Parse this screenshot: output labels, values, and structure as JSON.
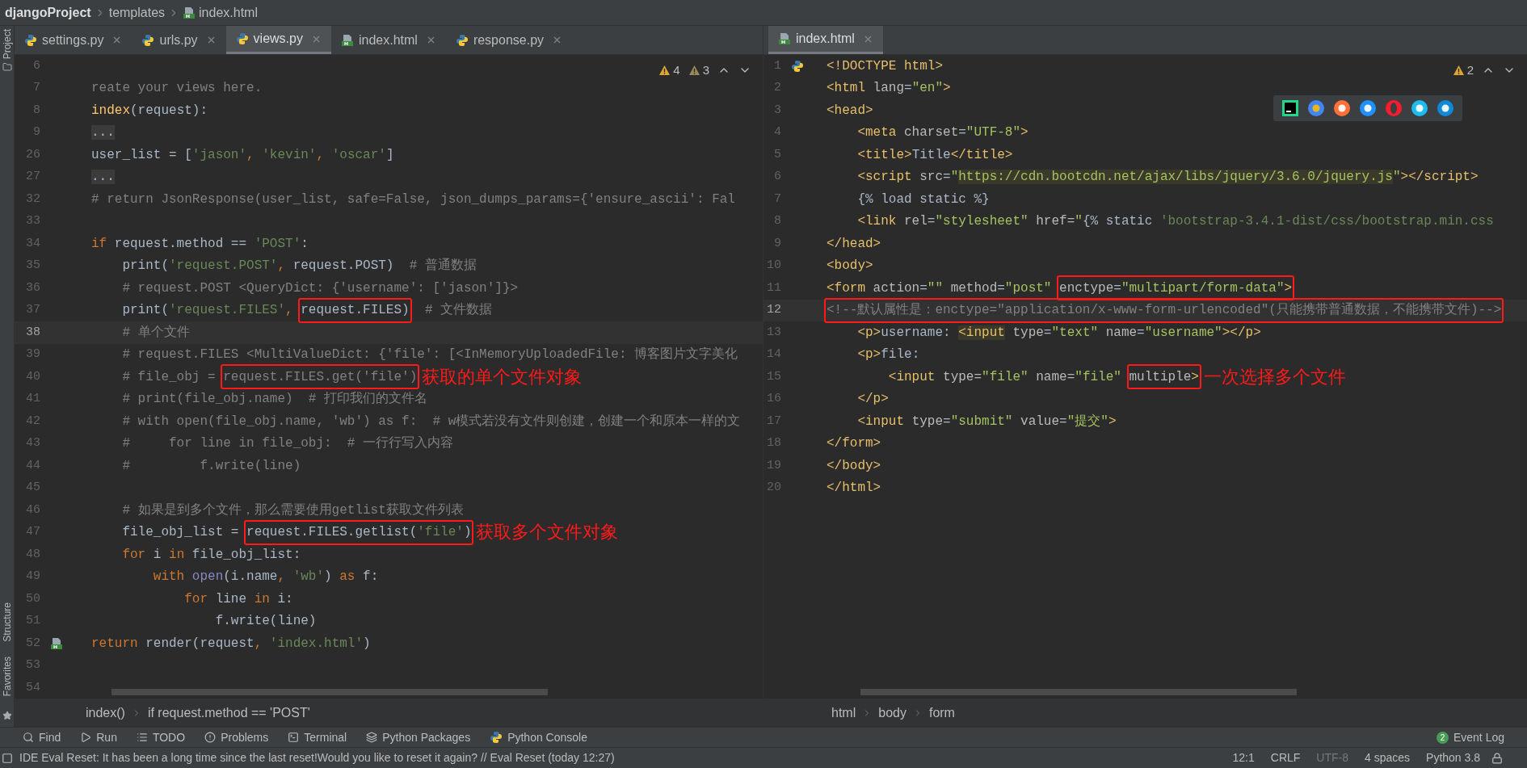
{
  "breadcrumb": [
    {
      "label": "djangoProject",
      "kind": "project"
    },
    {
      "label": "templates",
      "kind": "folder"
    },
    {
      "label": "index.html",
      "kind": "html"
    }
  ],
  "side_tools": [
    {
      "label": "Project",
      "kind": "top"
    },
    {
      "label": "Structure",
      "kind": "bottom"
    },
    {
      "label": "Favorites",
      "kind": "bottom"
    }
  ],
  "left_editor": {
    "tabs": [
      {
        "label": "settings.py",
        "kind": "py",
        "selected": false
      },
      {
        "label": "urls.py",
        "kind": "py",
        "selected": false
      },
      {
        "label": "views.py",
        "kind": "py",
        "selected": true
      },
      {
        "label": "index.html",
        "kind": "html",
        "selected": false
      },
      {
        "label": "response.py",
        "kind": "py",
        "selected": false
      }
    ],
    "warnings": "4",
    "weak_warnings": "3",
    "lines": [
      {
        "n": "6",
        "current": false
      },
      {
        "n": "7",
        "current": false,
        "segs": [
          {
            "kind": "comment",
            "text": "reate your views here."
          }
        ]
      },
      {
        "n": "8",
        "current": false,
        "segs": [
          {
            "kind": "def",
            "text": "index"
          },
          {
            "kind": "plain",
            "text": "(request):"
          }
        ]
      },
      {
        "n": "9",
        "current": false,
        "segs": [
          {
            "kind": "fold",
            "text": "..."
          }
        ]
      },
      {
        "n": "26",
        "current": false,
        "segs": [
          {
            "kind": "plain",
            "text": "user_list = ["
          },
          {
            "kind": "string",
            "text": "'jason'"
          },
          {
            "kind": "keyword",
            "text": ", "
          },
          {
            "kind": "string",
            "text": "'kevin'"
          },
          {
            "kind": "keyword",
            "text": ", "
          },
          {
            "kind": "string",
            "text": "'oscar'"
          },
          {
            "kind": "plain",
            "text": "]"
          }
        ]
      },
      {
        "n": "27",
        "current": false,
        "segs": [
          {
            "kind": "fold",
            "text": "..."
          }
        ]
      },
      {
        "n": "32",
        "current": false,
        "segs": [
          {
            "kind": "comment",
            "text": "# return JsonResponse(user_list, safe=False, json_dumps_params={'ensure_ascii': Fal"
          }
        ]
      },
      {
        "n": "33",
        "current": false
      },
      {
        "n": "34",
        "current": false,
        "segs": [
          {
            "kind": "keyword",
            "text": "if"
          },
          {
            "kind": "plain",
            "text": " request.method == "
          },
          {
            "kind": "string",
            "text": "'POST'"
          },
          {
            "kind": "plain",
            "text": ":"
          }
        ]
      },
      {
        "n": "35",
        "current": false,
        "segs": [
          {
            "kind": "plain",
            "text": "    print("
          },
          {
            "kind": "string",
            "text": "'request.POST'"
          },
          {
            "kind": "keyword",
            "text": ", "
          },
          {
            "kind": "plain",
            "text": "request.POST)  "
          },
          {
            "kind": "comment",
            "text": "# 普通数据"
          }
        ]
      },
      {
        "n": "36",
        "current": false,
        "segs": [
          {
            "kind": "comment",
            "text": "    # request.POST <QueryDict: {'username': ['jason']}>"
          }
        ]
      },
      {
        "n": "37",
        "current": false,
        "segs": [
          {
            "kind": "plain",
            "text": "    print("
          },
          {
            "kind": "string",
            "text": "'request.FILES'"
          },
          {
            "kind": "keyword",
            "text": ", "
          },
          {
            "kind": "box",
            "segs": [
              {
                "kind": "plain",
                "text": "request.FILES)"
              }
            ]
          },
          {
            "kind": "comment",
            "text": "  # 文件数据"
          }
        ]
      },
      {
        "n": "38",
        "current": true,
        "segs": [
          {
            "kind": "comment",
            "text": "    # 单个文件"
          }
        ]
      },
      {
        "n": "39",
        "current": false,
        "segs": [
          {
            "kind": "comment",
            "text": "    # request.FILES <MultiValueDict: {'file': [<InMemoryUploadedFile: 博客图片文字美化"
          }
        ]
      },
      {
        "n": "40",
        "current": false,
        "segs": [
          {
            "kind": "comment",
            "text": "    # file_obj = "
          },
          {
            "kind": "box",
            "segs": [
              {
                "kind": "comment",
                "text": "request.FILES.get('file')"
              }
            ]
          }
        ],
        "note": "获取的单个文件对象"
      },
      {
        "n": "41",
        "current": false,
        "segs": [
          {
            "kind": "comment",
            "text": "    # print(file_obj.name)  # 打印我们的文件名"
          }
        ]
      },
      {
        "n": "42",
        "current": false,
        "segs": [
          {
            "kind": "comment",
            "text": "    # with open(file_obj.name, 'wb') as f:  # w模式若没有文件则创建，创建一个和原本一样的文"
          }
        ]
      },
      {
        "n": "43",
        "current": false,
        "segs": [
          {
            "kind": "comment",
            "text": "    #     for line in file_obj:  # 一行行写入内容"
          }
        ]
      },
      {
        "n": "44",
        "current": false,
        "segs": [
          {
            "kind": "comment",
            "text": "    #         f.write(line)"
          }
        ]
      },
      {
        "n": "45",
        "current": false
      },
      {
        "n": "46",
        "current": false,
        "segs": [
          {
            "kind": "comment",
            "text": "    # 如果是到多个文件，那么需要使用getlist获取文件列表"
          }
        ]
      },
      {
        "n": "47",
        "current": false,
        "segs": [
          {
            "kind": "plain",
            "text": "    file_obj_list = "
          },
          {
            "kind": "box",
            "segs": [
              {
                "kind": "plain",
                "text": "request.FILES.getlist("
              },
              {
                "kind": "string",
                "text": "'file'"
              },
              {
                "kind": "plain",
                "text": ")"
              }
            ]
          }
        ],
        "note": "获取多个文件对象"
      },
      {
        "n": "48",
        "current": false,
        "segs": [
          {
            "kind": "keyword",
            "text": "    for"
          },
          {
            "kind": "plain",
            "text": " i "
          },
          {
            "kind": "keyword",
            "text": "in"
          },
          {
            "kind": "plain",
            "text": " file_obj_list:"
          }
        ]
      },
      {
        "n": "49",
        "current": false,
        "segs": [
          {
            "kind": "keyword",
            "text": "        with"
          },
          {
            "kind": "builtin",
            "text": " open"
          },
          {
            "kind": "plain",
            "text": "(i.name"
          },
          {
            "kind": "keyword",
            "text": ", "
          },
          {
            "kind": "string",
            "text": "'wb'"
          },
          {
            "kind": "plain",
            "text": ") "
          },
          {
            "kind": "keyword",
            "text": "as"
          },
          {
            "kind": "plain",
            "text": " f:"
          }
        ]
      },
      {
        "n": "50",
        "current": false,
        "segs": [
          {
            "kind": "keyword",
            "text": "            for"
          },
          {
            "kind": "plain",
            "text": " line "
          },
          {
            "kind": "keyword",
            "text": "in"
          },
          {
            "kind": "plain",
            "text": " i:"
          }
        ]
      },
      {
        "n": "51",
        "current": false,
        "segs": [
          {
            "kind": "plain",
            "text": "                f.write(line)"
          }
        ]
      },
      {
        "n": "52",
        "current": false,
        "icon": {
          "kind": "html"
        },
        "segs": [
          {
            "kind": "keyword",
            "text": "return"
          },
          {
            "kind": "plain",
            "text": " render(request"
          },
          {
            "kind": "keyword",
            "text": ", "
          },
          {
            "kind": "string",
            "text": "'index.html'"
          },
          {
            "kind": "plain",
            "text": ")"
          }
        ]
      },
      {
        "n": "53",
        "current": false
      },
      {
        "n": "54",
        "current": false
      }
    ],
    "crumbs": [
      "index()",
      "if request.method == 'POST'"
    ]
  },
  "right_editor": {
    "tabs": [
      {
        "label": "index.html",
        "kind": "html",
        "selected": true
      }
    ],
    "warnings": "2",
    "lines": [
      {
        "n": "1",
        "current": false,
        "icon": {
          "kind": "python"
        },
        "segs": [
          {
            "kind": "tag",
            "text": "<!DOCTYPE html>"
          }
        ]
      },
      {
        "n": "2",
        "current": false,
        "segs": [
          {
            "kind": "tag",
            "text": "<html "
          },
          {
            "kind": "attr",
            "text": "lang"
          },
          {
            "kind": "plain",
            "text": "="
          },
          {
            "kind": "value",
            "text": "\"en\""
          },
          {
            "kind": "tag",
            "text": ">"
          }
        ]
      },
      {
        "n": "3",
        "current": false,
        "segs": [
          {
            "kind": "tag",
            "text": "<head>"
          }
        ]
      },
      {
        "n": "4",
        "current": false,
        "segs": [
          {
            "kind": "tag",
            "text": "    <meta "
          },
          {
            "kind": "attr",
            "text": "charset"
          },
          {
            "kind": "plain",
            "text": "="
          },
          {
            "kind": "value",
            "text": "\"UTF-8\""
          },
          {
            "kind": "tag",
            "text": ">"
          }
        ]
      },
      {
        "n": "5",
        "current": false,
        "segs": [
          {
            "kind": "tag",
            "text": "    <title>"
          },
          {
            "kind": "plain",
            "text": "Title"
          },
          {
            "kind": "tag",
            "text": "</title>"
          }
        ]
      },
      {
        "n": "6",
        "current": false,
        "segs": [
          {
            "kind": "tag",
            "text": "    <script "
          },
          {
            "kind": "attr",
            "text": "src"
          },
          {
            "kind": "plain",
            "text": "="
          },
          {
            "kind": "value",
            "text": "\""
          },
          {
            "kind": "url",
            "text": "https://cdn.bootcdn.net/ajax/libs/jquery/3.6.0/jquery.js"
          },
          {
            "kind": "value",
            "text": "\""
          },
          {
            "kind": "tag",
            "text": "></script>"
          }
        ]
      },
      {
        "n": "7",
        "current": false,
        "segs": [
          {
            "kind": "plain",
            "text": "    {% load static %}"
          }
        ]
      },
      {
        "n": "8",
        "current": false,
        "segs": [
          {
            "kind": "tag",
            "text": "    <link "
          },
          {
            "kind": "attr",
            "text": "rel"
          },
          {
            "kind": "plain",
            "text": "="
          },
          {
            "kind": "value",
            "text": "\"stylesheet\""
          },
          {
            "kind": "attr",
            "text": " href"
          },
          {
            "kind": "plain",
            "text": "="
          },
          {
            "kind": "value",
            "text": "\""
          },
          {
            "kind": "plain",
            "text": "{% static "
          },
          {
            "kind": "string",
            "text": "'bootstrap-3.4.1-dist/css/bootstrap.min.css"
          }
        ]
      },
      {
        "n": "9",
        "current": false,
        "segs": [
          {
            "kind": "tag",
            "text": "</head>"
          }
        ]
      },
      {
        "n": "10",
        "current": false,
        "segs": [
          {
            "kind": "tag",
            "text": "<body>"
          }
        ]
      },
      {
        "n": "11",
        "current": false,
        "segs": [
          {
            "kind": "tag",
            "text": "<form "
          },
          {
            "kind": "attr",
            "text": "action"
          },
          {
            "kind": "plain",
            "text": "="
          },
          {
            "kind": "value",
            "text": "\"\""
          },
          {
            "kind": "attr",
            "text": " method"
          },
          {
            "kind": "plain",
            "text": "="
          },
          {
            "kind": "value",
            "text": "\"post\" "
          },
          {
            "kind": "box",
            "segs": [
              {
                "kind": "attr",
                "text": "enctype"
              },
              {
                "kind": "plain",
                "text": "="
              },
              {
                "kind": "value",
                "text": "\"multipart/form-data\""
              },
              {
                "kind": "tag",
                "text": ">"
              }
            ]
          }
        ]
      },
      {
        "n": "12",
        "current": true,
        "segs": [
          {
            "kind": "box",
            "segs": [
              {
                "kind": "comment",
                "text": "<!--默认属性是：enctype=\"application/x-www-form-urlencoded\"(只能携带普通数据，不能携带文件)-->"
              }
            ]
          }
        ]
      },
      {
        "n": "13",
        "current": false,
        "segs": [
          {
            "kind": "tag",
            "text": "    <p>"
          },
          {
            "kind": "plain",
            "text": "username: "
          },
          {
            "kind": "marked_tag",
            "text": "<input"
          },
          {
            "kind": "attr",
            "text": " type"
          },
          {
            "kind": "plain",
            "text": "="
          },
          {
            "kind": "value",
            "text": "\"text\""
          },
          {
            "kind": "attr",
            "text": " name"
          },
          {
            "kind": "plain",
            "text": "="
          },
          {
            "kind": "value",
            "text": "\"username\""
          },
          {
            "kind": "tag",
            "text": "></p>"
          }
        ]
      },
      {
        "n": "14",
        "current": false,
        "segs": [
          {
            "kind": "tag",
            "text": "    <p>"
          },
          {
            "kind": "plain",
            "text": "file:"
          }
        ]
      },
      {
        "n": "15",
        "current": false,
        "segs": [
          {
            "kind": "tag",
            "text": "        <input "
          },
          {
            "kind": "attr",
            "text": "type"
          },
          {
            "kind": "plain",
            "text": "="
          },
          {
            "kind": "value",
            "text": "\"file\""
          },
          {
            "kind": "attr",
            "text": " name"
          },
          {
            "kind": "plain",
            "text": "="
          },
          {
            "kind": "value",
            "text": "\"file\" "
          },
          {
            "kind": "box",
            "segs": [
              {
                "kind": "attr",
                "text": "multiple"
              },
              {
                "kind": "tag",
                "text": ">"
              }
            ]
          }
        ],
        "note": "一次选择多个文件"
      },
      {
        "n": "16",
        "current": false,
        "segs": [
          {
            "kind": "tag",
            "text": "    </p>"
          }
        ]
      },
      {
        "n": "17",
        "current": false,
        "segs": [
          {
            "kind": "tag",
            "text": "    <input "
          },
          {
            "kind": "attr",
            "text": "type"
          },
          {
            "kind": "plain",
            "text": "="
          },
          {
            "kind": "value",
            "text": "\"submit\""
          },
          {
            "kind": "attr",
            "text": " value"
          },
          {
            "kind": "plain",
            "text": "="
          },
          {
            "kind": "value",
            "text": "\"提交\""
          },
          {
            "kind": "tag",
            "text": ">"
          }
        ]
      },
      {
        "n": "18",
        "current": false,
        "segs": [
          {
            "kind": "tag",
            "text": "</form>"
          }
        ]
      },
      {
        "n": "19",
        "current": false,
        "segs": [
          {
            "kind": "tag",
            "text": "</body>"
          }
        ]
      },
      {
        "n": "20",
        "current": false,
        "segs": [
          {
            "kind": "tag",
            "text": "</html>"
          }
        ]
      }
    ],
    "crumbs": [
      "html",
      "body",
      "form"
    ]
  },
  "browsers": [
    {
      "kind": "pycharm"
    },
    {
      "kind": "chrome"
    },
    {
      "kind": "firefox"
    },
    {
      "kind": "safari"
    },
    {
      "kind": "opera"
    },
    {
      "kind": "ie"
    },
    {
      "kind": "edge"
    }
  ],
  "tool_windows": [
    {
      "label": "Find",
      "kind": "find"
    },
    {
      "label": "Run",
      "kind": "run"
    },
    {
      "label": "TODO",
      "kind": "todo"
    },
    {
      "label": "Problems",
      "kind": "problems"
    },
    {
      "label": "Terminal",
      "kind": "terminal"
    },
    {
      "label": "Python Packages",
      "kind": "packages"
    },
    {
      "label": "Python Console",
      "kind": "console"
    }
  ],
  "event_log": {
    "label": "Event Log",
    "count": "2"
  },
  "status_bar": {
    "message": "IDE Eval Reset: It has been a long time since the last reset!Would you like to reset it again? // Eval Reset (today 12:27)",
    "items": [
      {
        "label": "12:1",
        "disabled": false
      },
      {
        "label": "CRLF",
        "disabled": false
      },
      {
        "label": "UTF-8",
        "disabled": true
      },
      {
        "label": "4 spaces",
        "disabled": false
      },
      {
        "label": "Python 3.8",
        "disabled": false
      }
    ]
  }
}
